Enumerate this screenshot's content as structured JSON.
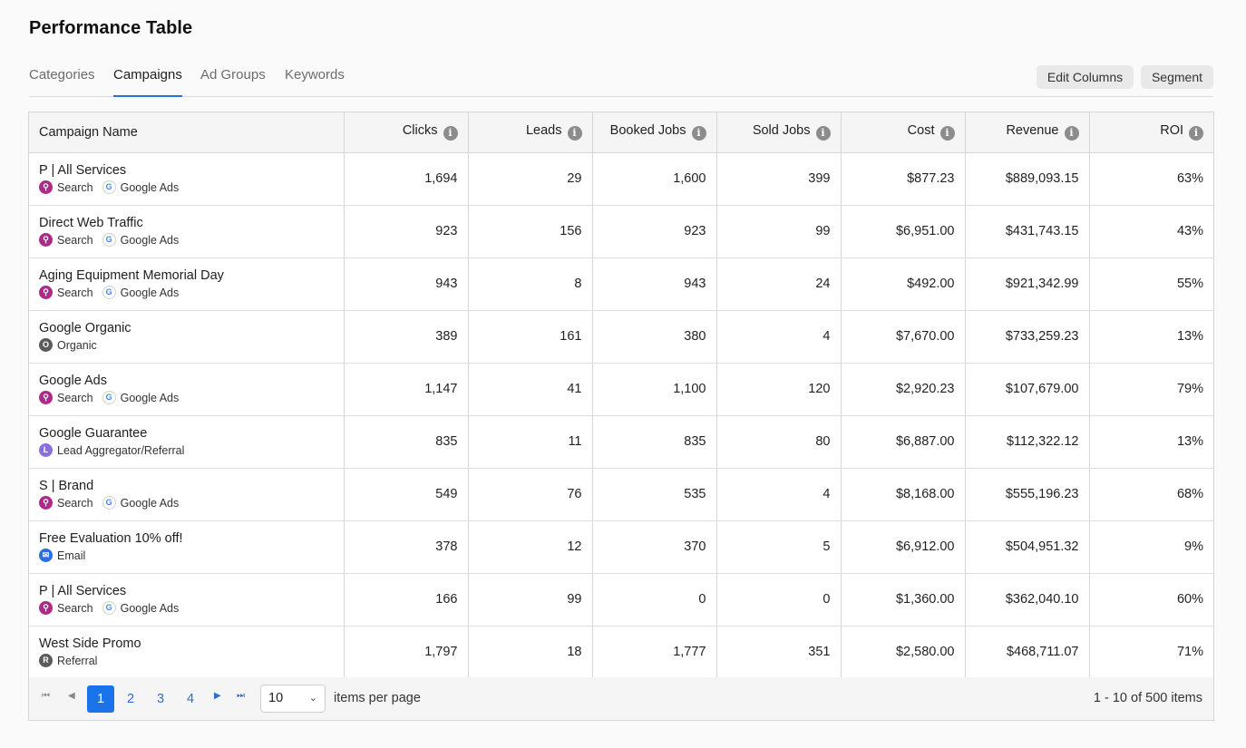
{
  "page": {
    "title": "Performance Table"
  },
  "tabs": [
    {
      "label": "Categories",
      "active": false
    },
    {
      "label": "Campaigns",
      "active": true
    },
    {
      "label": "Ad Groups",
      "active": false
    },
    {
      "label": "Keywords",
      "active": false
    }
  ],
  "actions": {
    "edit_columns": "Edit Columns",
    "segment": "Segment"
  },
  "table": {
    "columns": [
      "Campaign Name",
      "Clicks",
      "Leads",
      "Booked Jobs",
      "Sold Jobs",
      "Cost",
      "Revenue",
      "ROI"
    ],
    "info_glyph": "i",
    "rows": [
      {
        "name": "P | All Services",
        "tags": [
          {
            "label": "Search",
            "icon": "search-icon",
            "color": "#b0298a",
            "glyph": "⚲"
          },
          {
            "label": "Google Ads",
            "icon": "google-icon",
            "color": "#ffffff",
            "glyph": "G"
          }
        ],
        "values": [
          "1,694",
          "29",
          "1,600",
          "399",
          "$877.23",
          "$889,093.15",
          "63%"
        ]
      },
      {
        "name": "Direct Web Traffic",
        "tags": [
          {
            "label": "Search",
            "icon": "search-icon",
            "color": "#b0298a",
            "glyph": "⚲"
          },
          {
            "label": "Google Ads",
            "icon": "google-icon",
            "color": "#ffffff",
            "glyph": "G"
          }
        ],
        "values": [
          "923",
          "156",
          "923",
          "99",
          "$6,951.00",
          "$431,743.15",
          "43%"
        ]
      },
      {
        "name": "Aging Equipment Memorial Day",
        "tags": [
          {
            "label": "Search",
            "icon": "search-icon",
            "color": "#b0298a",
            "glyph": "⚲"
          },
          {
            "label": "Google Ads",
            "icon": "google-icon",
            "color": "#ffffff",
            "glyph": "G"
          }
        ],
        "values": [
          "943",
          "8",
          "943",
          "24",
          "$492.00",
          "$921,342.99",
          "55%"
        ]
      },
      {
        "name": "Google Organic",
        "tags": [
          {
            "label": "Organic",
            "icon": "organic-icon",
            "color": "#5b5b5b",
            "glyph": "O"
          }
        ],
        "values": [
          "389",
          "161",
          "380",
          "4",
          "$7,670.00",
          "$733,259.23",
          "13%"
        ]
      },
      {
        "name": "Google Ads",
        "tags": [
          {
            "label": "Search",
            "icon": "search-icon",
            "color": "#b0298a",
            "glyph": "⚲"
          },
          {
            "label": "Google Ads",
            "icon": "google-icon",
            "color": "#ffffff",
            "glyph": "G"
          }
        ],
        "values": [
          "1,147",
          "41",
          "1,100",
          "120",
          "$2,920.23",
          "$107,679.00",
          "79%"
        ]
      },
      {
        "name": "Google Guarantee",
        "tags": [
          {
            "label": "Lead Aggregator/Referral",
            "icon": "lead-aggregator-icon",
            "color": "#8a6fe0",
            "glyph": "L"
          }
        ],
        "values": [
          "835",
          "11",
          "835",
          "80",
          "$6,887.00",
          "$112,322.12",
          "13%"
        ]
      },
      {
        "name": "S | Brand",
        "tags": [
          {
            "label": "Search",
            "icon": "search-icon",
            "color": "#b0298a",
            "glyph": "⚲"
          },
          {
            "label": "Google Ads",
            "icon": "google-icon",
            "color": "#ffffff",
            "glyph": "G"
          }
        ],
        "values": [
          "549",
          "76",
          "535",
          "4",
          "$8,168.00",
          "$555,196.23",
          "68%"
        ]
      },
      {
        "name": "Free Evaluation 10% off!",
        "tags": [
          {
            "label": "Email",
            "icon": "email-icon",
            "color": "#2a6fdb",
            "glyph": "✉"
          }
        ],
        "values": [
          "378",
          "12",
          "370",
          "5",
          "$6,912.00",
          "$504,951.32",
          "9%"
        ]
      },
      {
        "name": "P | All Services",
        "tags": [
          {
            "label": "Search",
            "icon": "search-icon",
            "color": "#b0298a",
            "glyph": "⚲"
          },
          {
            "label": "Google Ads",
            "icon": "google-icon",
            "color": "#ffffff",
            "glyph": "G"
          }
        ],
        "values": [
          "166",
          "99",
          "0",
          "0",
          "$1,360.00",
          "$362,040.10",
          "60%"
        ]
      },
      {
        "name": "West Side Promo",
        "tags": [
          {
            "label": "Referral",
            "icon": "referral-icon",
            "color": "#5b5b5b",
            "glyph": "R"
          }
        ],
        "values": [
          "1,797",
          "18",
          "1,777",
          "351",
          "$2,580.00",
          "$468,711.07",
          "71%"
        ]
      }
    ]
  },
  "pagination": {
    "first": "⏮",
    "prev": "◀",
    "next": "▶",
    "last": "⏭",
    "pages": [
      "1",
      "2",
      "3",
      "4"
    ],
    "current": "1",
    "per_page_value": "10",
    "per_page_label": "items per page",
    "summary": "1 - 10 of 500 items"
  }
}
